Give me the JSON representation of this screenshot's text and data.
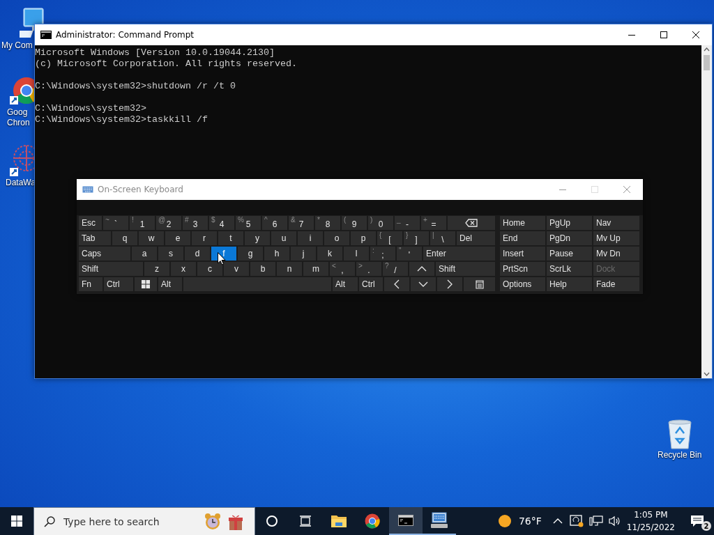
{
  "desktop_icons": [
    {
      "kind": "computer",
      "lines": [
        "My Com"
      ]
    },
    {
      "kind": "chrome",
      "lines": [
        "Goog",
        "Chron"
      ]
    },
    {
      "kind": "molecule",
      "lines": [
        "DataWa"
      ]
    },
    {
      "kind": "recycle",
      "lines": [
        "Recycle Bin"
      ]
    }
  ],
  "command_window": {
    "title": "Administrator: Command Prompt",
    "blocks": [
      [
        "Microsoft Windows [Version 10.0.19044.2130]",
        "(c) Microsoft Corporation. All rights reserved."
      ],
      [
        "C:\\Windows\\system32>shutdown /r /t 0"
      ],
      [
        "C:\\Windows\\system32>",
        "C:\\Windows\\system32>taskkill /f"
      ]
    ]
  },
  "keyboard_window": {
    "title": "On-Screen Keyboard",
    "rows": [
      [
        {
          "kind": "word",
          "label": "Esc",
          "selected": false
        },
        {
          "kind": "char",
          "shift": "~",
          "label": "`",
          "selected": false
        },
        {
          "kind": "char",
          "shift": "!",
          "label": "1",
          "selected": false
        },
        {
          "kind": "char",
          "shift": "@",
          "label": "2",
          "selected": false
        },
        {
          "kind": "char",
          "shift": "#",
          "label": "3",
          "selected": false
        },
        {
          "kind": "char",
          "shift": "$",
          "label": "4",
          "selected": false
        },
        {
          "kind": "char",
          "shift": "%",
          "label": "5",
          "selected": false
        },
        {
          "kind": "char",
          "shift": "^",
          "label": "6",
          "selected": false
        },
        {
          "kind": "char",
          "shift": "&",
          "label": "7",
          "selected": false
        },
        {
          "kind": "char",
          "shift": "*",
          "label": "8",
          "selected": false
        },
        {
          "kind": "char",
          "shift": "(",
          "label": "9",
          "selected": false
        },
        {
          "kind": "char",
          "shift": ")",
          "label": "0",
          "selected": false
        },
        {
          "kind": "char",
          "shift": "_",
          "label": "-",
          "selected": false
        },
        {
          "kind": "char",
          "shift": "+",
          "label": "=",
          "selected": false
        },
        {
          "kind": "backspace",
          "selected": false
        }
      ],
      [
        {
          "kind": "word",
          "label": "Tab",
          "selected": false
        },
        {
          "kind": "letter",
          "label": "q",
          "selected": false
        },
        {
          "kind": "letter",
          "label": "w",
          "selected": false
        },
        {
          "kind": "letter",
          "label": "e",
          "selected": false
        },
        {
          "kind": "letter",
          "label": "r",
          "selected": false
        },
        {
          "kind": "letter",
          "label": "t",
          "selected": false
        },
        {
          "kind": "letter",
          "label": "y",
          "selected": false
        },
        {
          "kind": "letter",
          "label": "u",
          "selected": false
        },
        {
          "kind": "letter",
          "label": "i",
          "selected": false
        },
        {
          "kind": "letter",
          "label": "o",
          "selected": false
        },
        {
          "kind": "letter",
          "label": "p",
          "selected": false
        },
        {
          "kind": "char",
          "shift": "{",
          "label": "[",
          "selected": false
        },
        {
          "kind": "char",
          "shift": "}",
          "label": "]",
          "selected": false
        },
        {
          "kind": "char",
          "shift": "|",
          "label": "\\",
          "selected": false
        },
        {
          "kind": "word",
          "label": "Del",
          "selected": false
        }
      ],
      [
        {
          "kind": "word",
          "label": "Caps",
          "selected": false
        },
        {
          "kind": "letter",
          "label": "a",
          "selected": false
        },
        {
          "kind": "letter",
          "label": "s",
          "selected": false
        },
        {
          "kind": "letter",
          "label": "d",
          "selected": false
        },
        {
          "kind": "letter",
          "label": "f",
          "selected": true
        },
        {
          "kind": "letter",
          "label": "g",
          "selected": false
        },
        {
          "kind": "letter",
          "label": "h",
          "selected": false
        },
        {
          "kind": "letter",
          "label": "j",
          "selected": false
        },
        {
          "kind": "letter",
          "label": "k",
          "selected": false
        },
        {
          "kind": "letter",
          "label": "l",
          "selected": false
        },
        {
          "kind": "char",
          "shift": ":",
          "label": ";",
          "selected": false
        },
        {
          "kind": "char",
          "shift": "\"",
          "label": "'",
          "selected": false
        },
        {
          "kind": "word",
          "label": "Enter",
          "selected": false
        }
      ],
      [
        {
          "kind": "word",
          "label": "Shift",
          "selected": false
        },
        {
          "kind": "letter",
          "label": "z",
          "selected": false
        },
        {
          "kind": "letter",
          "label": "x",
          "selected": false
        },
        {
          "kind": "letter",
          "label": "c",
          "selected": false
        },
        {
          "kind": "letter",
          "label": "v",
          "selected": false
        },
        {
          "kind": "letter",
          "label": "b",
          "selected": false
        },
        {
          "kind": "letter",
          "label": "n",
          "selected": false
        },
        {
          "kind": "letter",
          "label": "m",
          "selected": false
        },
        {
          "kind": "char",
          "shift": "<",
          "label": ",",
          "selected": false
        },
        {
          "kind": "char",
          "shift": ">",
          "label": ".",
          "selected": false
        },
        {
          "kind": "char",
          "shift": "?",
          "label": "/",
          "selected": false
        },
        {
          "kind": "up",
          "selected": false
        },
        {
          "kind": "word",
          "label": "Shift",
          "selected": false
        }
      ],
      [
        {
          "kind": "word",
          "label": "Fn",
          "selected": false
        },
        {
          "kind": "word",
          "label": "Ctrl",
          "selected": false
        },
        {
          "kind": "windows",
          "selected": false
        },
        {
          "kind": "word",
          "label": "Alt",
          "selected": false
        },
        {
          "kind": "space",
          "selected": false
        },
        {
          "kind": "word",
          "label": "Alt",
          "selected": false
        },
        {
          "kind": "word",
          "label": "Ctrl",
          "selected": false
        },
        {
          "kind": "left",
          "selected": false
        },
        {
          "kind": "down",
          "selected": false
        },
        {
          "kind": "right",
          "selected": false
        },
        {
          "kind": "menu",
          "selected": false
        }
      ]
    ],
    "nav_keys": [
      {
        "label": "Home",
        "disabled": false
      },
      {
        "label": "PgUp",
        "disabled": false
      },
      {
        "label": "Nav",
        "disabled": false
      },
      {
        "label": "End",
        "disabled": false
      },
      {
        "label": "PgDn",
        "disabled": false
      },
      {
        "label": "Mv Up",
        "disabled": false
      },
      {
        "label": "Insert",
        "disabled": false
      },
      {
        "label": "Pause",
        "disabled": false
      },
      {
        "label": "Mv Dn",
        "disabled": false
      },
      {
        "label": "PrtScn",
        "disabled": false
      },
      {
        "label": "ScrLk",
        "disabled": false
      },
      {
        "label": "Dock",
        "disabled": true
      },
      {
        "label": "Options",
        "disabled": false
      },
      {
        "label": "Help",
        "disabled": false
      },
      {
        "label": "Fade",
        "disabled": false
      }
    ]
  },
  "taskbar": {
    "search": {
      "placeholder": "Type here to search"
    },
    "apps": [
      {
        "kind": "explorer",
        "selected": false,
        "running": false
      },
      {
        "kind": "chrome",
        "selected": false,
        "running": false
      },
      {
        "kind": "terminal",
        "selected": true,
        "running": true
      },
      {
        "kind": "keyboard",
        "selected": false,
        "running": true
      }
    ],
    "weather": "76°F",
    "time": "1:05 PM",
    "date": "11/25/2022",
    "notifications": "2"
  }
}
